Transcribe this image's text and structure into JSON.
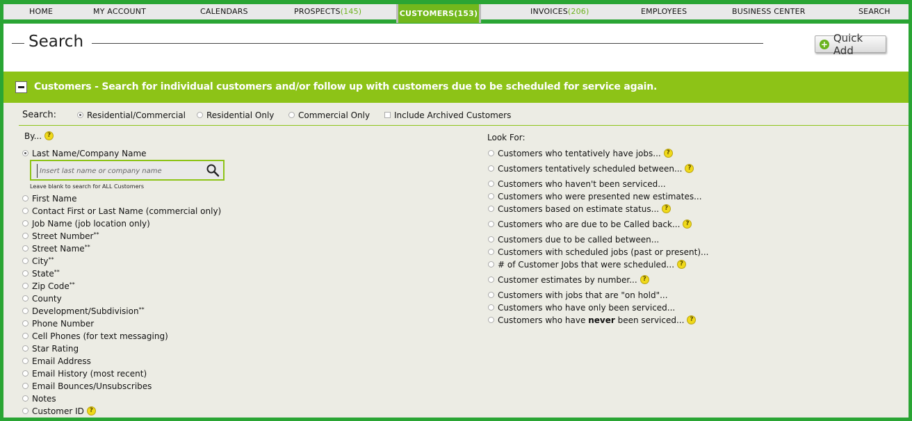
{
  "nav": {
    "items": [
      {
        "label": "HOME",
        "count": ""
      },
      {
        "label": "MY ACCOUNT",
        "count": ""
      },
      {
        "label": "CALENDARS",
        "count": ""
      },
      {
        "label": "PROSPECTS",
        "count": "(145)"
      },
      {
        "label": "CUSTOMERS",
        "count": "(153)"
      },
      {
        "label": "INVOICES",
        "count": "(206)"
      },
      {
        "label": "EMPLOYEES",
        "count": ""
      },
      {
        "label": "BUSINESS CENTER",
        "count": ""
      },
      {
        "label": "SEARCH",
        "count": ""
      }
    ],
    "active": "CUSTOMERS"
  },
  "page": {
    "title": "Search",
    "quick_add_label": "Quick Add"
  },
  "band": {
    "text": "Customers - Search for individual customers and/or follow up with customers due to be scheduled for service again."
  },
  "search_row": {
    "label": "Search:",
    "options": [
      {
        "label": "Residential/Commercial",
        "type": "radio",
        "checked": true
      },
      {
        "label": "Residential Only",
        "type": "radio",
        "checked": false
      },
      {
        "label": "Commercial Only",
        "type": "radio",
        "checked": false
      },
      {
        "label": "Include Archived Customers",
        "type": "checkbox",
        "checked": false
      }
    ]
  },
  "by": {
    "label": "By...",
    "first_option": "Last Name/Company Name",
    "input_placeholder": "Insert last name or company name",
    "hint": "Leave blank to search for ALL Customers",
    "options": [
      {
        "label": "First Name",
        "ast": ""
      },
      {
        "label": "Contact First or Last Name (commercial only)",
        "ast": ""
      },
      {
        "label": "Job Name (job location only)",
        "ast": ""
      },
      {
        "label": "Street Number",
        "ast": "**"
      },
      {
        "label": "Street Name",
        "ast": "**"
      },
      {
        "label": "City",
        "ast": "**"
      },
      {
        "label": "State",
        "ast": "**"
      },
      {
        "label": "Zip Code",
        "ast": "**"
      },
      {
        "label": "County",
        "ast": ""
      },
      {
        "label": "Development/Subdivision",
        "ast": "**"
      },
      {
        "label": "Phone Number",
        "ast": ""
      },
      {
        "label": "Cell Phones (for text messaging)",
        "ast": ""
      },
      {
        "label": "Star Rating",
        "ast": ""
      },
      {
        "label": "Email Address",
        "ast": ""
      },
      {
        "label": "Email History (most recent)",
        "ast": ""
      },
      {
        "label": "Email Bounces/Unsubscribes",
        "ast": ""
      },
      {
        "label": "Notes",
        "ast": ""
      },
      {
        "label": "Customer ID",
        "ast": "",
        "help": true
      }
    ]
  },
  "look_for": {
    "label": "Look For:",
    "options": [
      {
        "label": "Customers who tentatively have jobs...",
        "help": true
      },
      {
        "label": "Customers tentatively scheduled between...",
        "help": true
      },
      {
        "label": "Customers who haven't been serviced...",
        "help": false
      },
      {
        "label": "Customers who were presented new estimates...",
        "help": false
      },
      {
        "label": "Customers based on estimate status...",
        "help": true
      },
      {
        "label": "Customers who are due to be Called back...",
        "help": true
      },
      {
        "label": "Customers due to be called between...",
        "help": false
      },
      {
        "label": "Customers with scheduled jobs (past or present)...",
        "help": false
      },
      {
        "label": "# of Customer Jobs that were scheduled...",
        "help": true
      },
      {
        "label": "Customer estimates by number...",
        "help": true
      },
      {
        "label": "Customers with jobs that are \"on hold\"...",
        "help": false
      },
      {
        "label": "Customers who have only been serviced...",
        "help": false
      },
      {
        "label_pre": "Customers who have ",
        "label_bold": "never",
        "label_post": " been serviced...",
        "help": true
      }
    ]
  },
  "help_glyph": "?",
  "colors": {
    "brand_green": "#2aa534",
    "band_green": "#8dc317",
    "count_green": "#6cb11e",
    "help_yellow": "#f0d91a"
  }
}
